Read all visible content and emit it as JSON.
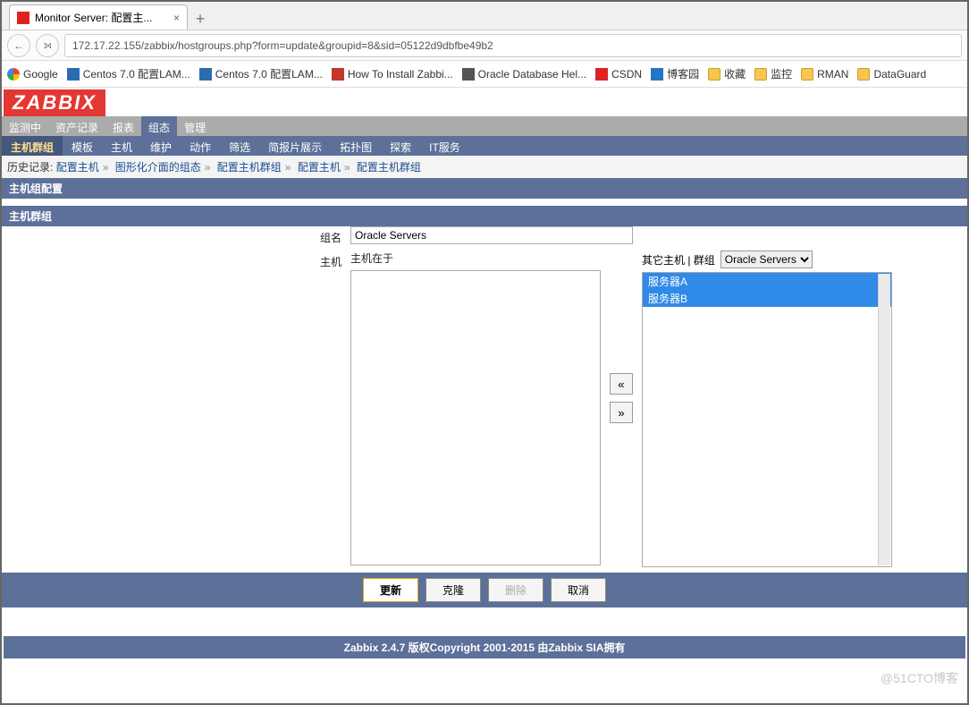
{
  "browser": {
    "tab_title": "Monitor Server: 配置主...",
    "url": "172.17.22.155/zabbix/hostgroups.php?form=update&groupid=8&sid=05122d9dbfbe49b2",
    "new_tab": "+",
    "close": "×",
    "back": "←"
  },
  "bookmarks": [
    {
      "label": "Google",
      "icon": "g"
    },
    {
      "label": "Centos 7.0 配置LAM...",
      "icon": "c"
    },
    {
      "label": "Centos 7.0 配置LAM...",
      "icon": "c"
    },
    {
      "label": "How To Install Zabbi...",
      "icon": "red"
    },
    {
      "label": "Oracle Database Hel...",
      "icon": "or"
    },
    {
      "label": "CSDN",
      "icon": "csdn"
    },
    {
      "label": "博客园",
      "icon": "bky"
    },
    {
      "label": "收藏",
      "icon": "folder"
    },
    {
      "label": "监控",
      "icon": "folder"
    },
    {
      "label": "RMAN",
      "icon": "folder"
    },
    {
      "label": "DataGuard",
      "icon": "folder"
    }
  ],
  "zabbix": {
    "logo": "ZABBIX",
    "menu1": [
      "监测中",
      "资产记录",
      "报表",
      "组态",
      "管理"
    ],
    "menu1_active": 3,
    "menu2": [
      "主机群组",
      "模板",
      "主机",
      "维护",
      "动作",
      "筛选",
      "简报片展示",
      "拓扑图",
      "探索",
      "IT服务"
    ],
    "menu2_active": 0,
    "history_label": "历史记录:",
    "history_items": [
      "配置主机",
      "图形化介面的组态",
      "配置主机群组",
      "配置主机",
      "配置主机群组"
    ]
  },
  "section": {
    "config_title": "主机组配置",
    "group_title": "主机群组"
  },
  "form": {
    "name_label": "组名",
    "name_value": "Oracle Servers",
    "hosts_label": "主机",
    "left_list_head": "主机在于",
    "right_list_head_label": "其它主机 | 群组",
    "right_list_select": "Oracle Servers",
    "right_items": [
      "服务器A",
      "服务器B"
    ],
    "move_left": "«",
    "move_right": "»"
  },
  "buttons": {
    "update": "更新",
    "clone": "克隆",
    "delete": "删除",
    "cancel": "取消"
  },
  "footer": "Zabbix 2.4.7 版权Copyright 2001-2015 由Zabbix SIA拥有",
  "watermark": "@51CTO博客"
}
